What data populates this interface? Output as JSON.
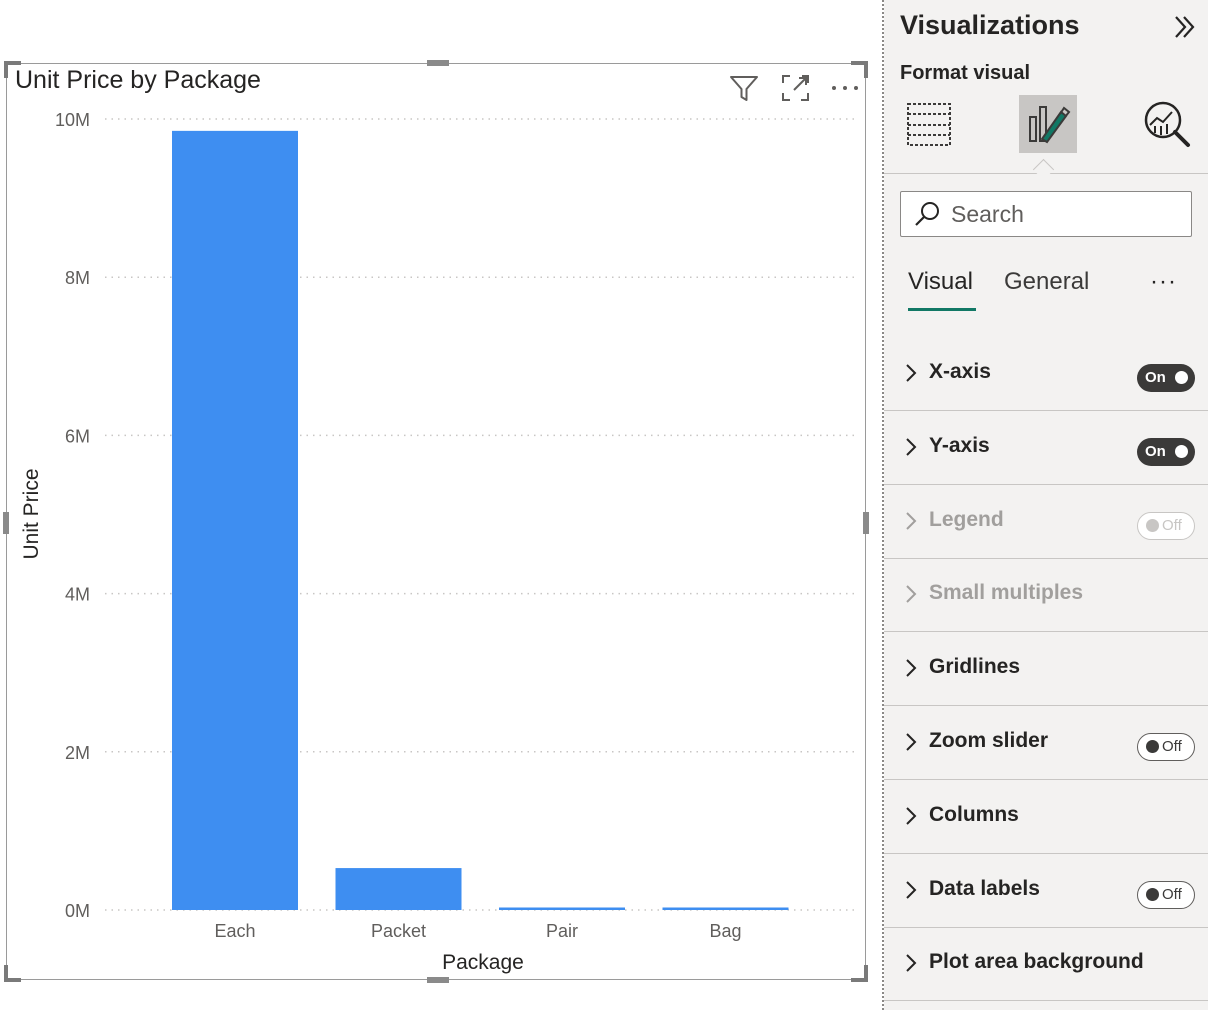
{
  "chart_data": {
    "type": "bar",
    "title": "Unit Price by Package",
    "xlabel": "Package",
    "ylabel": "Unit Price",
    "categories": [
      "Each",
      "Packet",
      "Pair",
      "Bag"
    ],
    "values": [
      9850000,
      530000,
      25000,
      25000
    ],
    "ylim": [
      0,
      10000000
    ],
    "yticks": [
      "0M",
      "2M",
      "4M",
      "6M",
      "8M",
      "10M"
    ],
    "grid": true,
    "bar_color": "#3e8ef1"
  },
  "visual_header": {
    "icons": [
      "filter-icon",
      "focus-mode-icon",
      "more-options-icon"
    ]
  },
  "pane": {
    "title": "Visualizations",
    "subtitle": "Format visual",
    "viz_icons": [
      "build-visual-icon",
      "format-visual-icon",
      "analytics-icon"
    ],
    "search_placeholder": "Search",
    "tabs": [
      {
        "label": "Visual",
        "active": true
      },
      {
        "label": "General",
        "active": false
      }
    ],
    "more_label": "···",
    "sections": [
      {
        "label": "X-axis",
        "toggle": "On",
        "enabled": true
      },
      {
        "label": "Y-axis",
        "toggle": "On",
        "enabled": true
      },
      {
        "label": "Legend",
        "toggle": "Off",
        "enabled": false
      },
      {
        "label": "Small multiples",
        "toggle": null,
        "enabled": false
      },
      {
        "label": "Gridlines",
        "toggle": null,
        "enabled": true
      },
      {
        "label": "Zoom slider",
        "toggle": "Off",
        "enabled": true
      },
      {
        "label": "Columns",
        "toggle": null,
        "enabled": true
      },
      {
        "label": "Data labels",
        "toggle": "Off",
        "enabled": true
      },
      {
        "label": "Plot area background",
        "toggle": null,
        "enabled": true
      }
    ]
  },
  "colors": {
    "accent": "#117865",
    "bar": "#3e8ef1",
    "toggle_on": "#3b3a39"
  }
}
